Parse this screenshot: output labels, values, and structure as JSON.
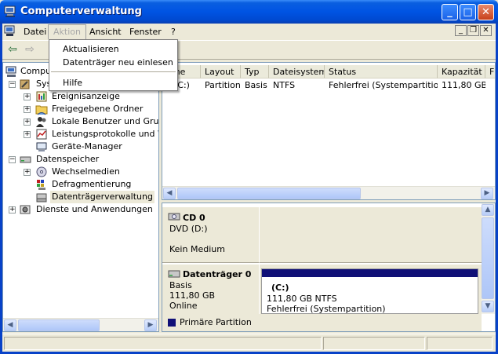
{
  "window": {
    "title": "Computerverwaltung",
    "minimize_label": "_",
    "maximize_label": "□",
    "close_label": "✕"
  },
  "menubar": {
    "items": [
      "Datei",
      "Aktion",
      "Ansicht",
      "Fenster",
      "?"
    ],
    "active_item": "Aktion"
  },
  "action_menu": {
    "items": [
      "Aktualisieren",
      "Datenträger neu einlesen",
      "Hilfe"
    ]
  },
  "tree": {
    "root_label": "Compu",
    "system_label": "Sys",
    "items": [
      "Ereignisanzeige",
      "Freigegebene Ordner",
      "Lokale Benutzer und Gruppe",
      "Leistungsprotokolle und War",
      "Geräte-Manager",
      "Datenspeicher",
      "Wechselmedien",
      "Defragmentierung",
      "Datenträgerverwaltung",
      "Dienste und Anwendungen"
    ],
    "selected_item": "Datenträgerverwaltung"
  },
  "volume_list": {
    "columns": [
      "ume",
      "Layout",
      "Typ",
      "Dateisystem",
      "Status",
      "Kapazität",
      "F"
    ],
    "rows": [
      [
        "(C:)",
        "Partition",
        "Basis",
        "NTFS",
        "Fehlerfrei (Systempartition)",
        "111,80 GB",
        ""
      ]
    ]
  },
  "disks": [
    {
      "name": "CD 0",
      "type": "DVD (D:)",
      "size": "",
      "state": "Kein Medium"
    },
    {
      "name": "Datenträger 0",
      "type": "Basis",
      "size": "111,80 GB",
      "state": "Online",
      "partition": {
        "label": "(C:)",
        "fs": "111,80 GB NTFS",
        "status": "Fehlerfrei (Systempartition)"
      }
    }
  ],
  "legend": {
    "primary_partition": "Primäre Partition",
    "primary_color": "#101077"
  },
  "colors": {
    "titlebar": "#0054e3",
    "window_bg": "#ece9d8",
    "selection_bar": "#101077"
  }
}
